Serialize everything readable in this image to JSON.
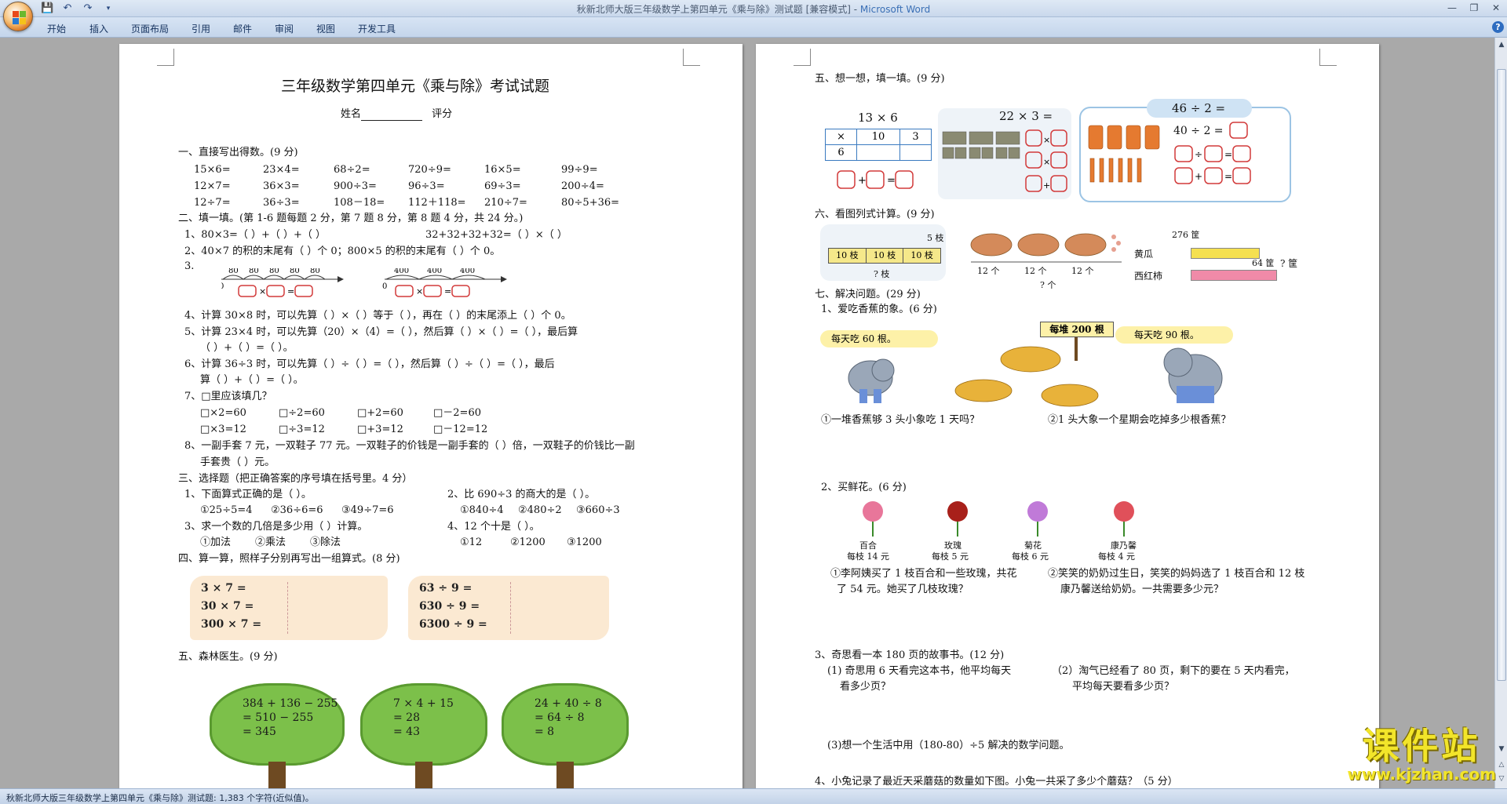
{
  "window": {
    "title": "秋新北师大版三年级数学上第四单元《乘与除》测试题 [兼容模式] - ",
    "app": "Microsoft Word"
  },
  "ribbon": {
    "tabs": [
      "开始",
      "插入",
      "页面布局",
      "引用",
      "邮件",
      "审阅",
      "视图",
      "开发工具"
    ]
  },
  "status": {
    "text": "秋新北师大版三年级数学上第四单元《乘与除》测试题: 1,383 个字符(近似值)。"
  },
  "left": {
    "title": "三年级数学第四单元《乘与除》考试试题",
    "name_line": "姓名",
    "score_label": "评分",
    "s1": "一、直接写出得数。(9 分)",
    "s1_rows": [
      [
        "15×6=",
        "23×4=",
        "68÷2=",
        "720÷9=",
        "16×5=",
        "99÷9="
      ],
      [
        "12×7=",
        "36×3=",
        "900÷3=",
        "96÷3=",
        "69÷3=",
        "200÷4="
      ],
      [
        "12÷7=",
        "36÷3=",
        "108－18=",
        "112＋118=",
        "210÷7=",
        "80÷5+36="
      ]
    ],
    "s2": "二、填一填。(第 1-6 题每题 2 分，第 7 题 8 分，第 8 题 4 分，共 24 分。)",
    "q1a": "1、80×3=（    ）+（      ）+（      ）",
    "q1b": "32+32+32+32=（      ）×（      ）",
    "q2": "2、40×7 的积的末尾有（     ）个 0；800×5 的积的末尾有（     ）个 0。",
    "q3": "3.",
    "num1": [
      "80",
      "80",
      "80",
      "80",
      "80"
    ],
    "num1_zero": "0",
    "num2": [
      "400",
      "400",
      "400"
    ],
    "num2_zero": "0",
    "q4": "4、计算 30×8 时，可以先算（   ）×（    ）等于（    ），再在（     ）的末尾添上（    ）个 0。",
    "q5a": "5、计算 23×4 时，可以先算（20）×（4）=（      ），然后算（      ）×（      ）=（        ），最后算",
    "q5b": "（      ）+（        ）=（         ）。",
    "q6a": "6、计算 36÷3 时，可以先算（    ）÷（    ）=（      ），然后算（      ）÷（      ）=（        ），最后",
    "q6b": "算（       ）+（        ）=（         ）。",
    "q7": "7、□里应该填几？",
    "q7_rows": [
      [
        "□×2=60",
        "□÷2=60",
        "□+2=60",
        "□－2=60"
      ],
      [
        "□×3=12",
        "□÷3=12",
        "□+3=12",
        "□－12=12"
      ]
    ],
    "q8a": "8、一副手套 7 元，一双鞋子 77 元。一双鞋子的价钱是一副手套的（     ）倍，一双鞋子的价钱比一副",
    "q8b": "手套贵（      ）元。",
    "s3": "三、选择题（把正确答案的序号填在括号里。4 分）",
    "c1": "1、下面算式正确的是（        ）。",
    "c1_opts": [
      "①25÷5=4",
      "②36÷6=6",
      "③49÷7=6"
    ],
    "c2": "2、比 690÷3 的商大的是（        ）。",
    "c2_opts": [
      "①840÷4",
      "②480÷2",
      "③660÷3"
    ],
    "c3": "3、求一个数的几倍是多少用（      ）计算。",
    "c3_opts": [
      "①加法",
      "②乘法",
      "③除法"
    ],
    "c4": "4、12 个十是（       ）。",
    "c4_opts": [
      "①12",
      "②1200",
      "③1200"
    ],
    "s4": "四、算一算，照样子分别再写出一组算式。(8 分)",
    "card1": [
      "3 × 7 =",
      "30 × 7 =",
      "300 × 7 ="
    ],
    "card2": [
      "63 ÷ 9 =",
      "630 ÷ 9 =",
      "6300 ÷ 9 ="
    ],
    "s5": "五、森林医生。(9 分)",
    "trees": [
      [
        "384 + 136 − 255",
        "= 510 − 255",
        "= 345"
      ],
      [
        "7 × 4 + 15",
        "= 28",
        "= 43"
      ],
      [
        "24 + 40 ÷ 8",
        "= 64 ÷ 8",
        "= 8"
      ]
    ]
  },
  "right": {
    "s5": "五、想一想，填一填。(9 分)",
    "f1_label": "13 × 6",
    "f1_row1": [
      "×",
      "10",
      "3"
    ],
    "f1_row2": [
      "6",
      "",
      ""
    ],
    "f2_label": "22 × 3 =",
    "f3_label": "46 ÷ 2 =",
    "f3_sub": "40 ÷ 2 =",
    "s6": "六、看图列式计算。(9 分)",
    "g1_top": "5 枝",
    "g1_cells": [
      "10 枝",
      "10 枝",
      "10 枝"
    ],
    "g1_bottom": "? 枝",
    "g2_labels": [
      "12 个",
      "12 个",
      "12 个"
    ],
    "g2_bottom": "? 个",
    "g3_top": "276 筐",
    "g3_row1": "黄瓜",
    "g3_row2": "西红柿",
    "g3_side": "64 筐",
    "g3_q": "? 筐",
    "s7": "七、解决问题。(29 分)",
    "p1": "1、爱吃香蕉的象。(6 分)",
    "bubble1": "每天吃 60 根。",
    "sign": "每堆 200 根",
    "bubble2": "每天吃 90 根。",
    "p1a": "①一堆香蕉够 3 头小象吃 1 天吗？",
    "p1b": "②1 头大象一个星期会吃掉多少根香蕉？",
    "p2": "2、买鲜花。(6 分)",
    "flowers": [
      [
        "百合",
        "每枝 14 元"
      ],
      [
        "玫瑰",
        "每枝 5 元"
      ],
      [
        "菊花",
        "每枝 6 元"
      ],
      [
        "康乃馨",
        "每枝 4 元"
      ]
    ],
    "p2a1": "①李阿姨买了 1 枝百合和一些玫瑰，共花",
    "p2a2": "了 54 元。她买了几枝玫瑰？",
    "p2b1": "②笑笑的奶奶过生日，笑笑的妈妈选了 1 枝百合和 12 枝",
    "p2b2": "康乃馨送给奶奶。一共需要多少元？",
    "p3": "3、奇思看一本 180 页的故事书。(12 分)",
    "p3a1": "(1) 奇思用 6 天看完这本书，他平均每天",
    "p3a2": "看多少页？",
    "p3b1": "（2）淘气已经看了 80 页，剩下的要在 5 天内看完，",
    "p3b2": "平均每天要看多少页？",
    "p3c": "(3)想一个生活中用（180-80）÷5 解决的数学问题。",
    "p4": "4、小兔记录了最近天采蘑菇的数量如下图。小兔一共采了多少个蘑菇？（5 分）"
  },
  "watermark": {
    "main": "课件站",
    "url": "www.kjzhan.com"
  }
}
